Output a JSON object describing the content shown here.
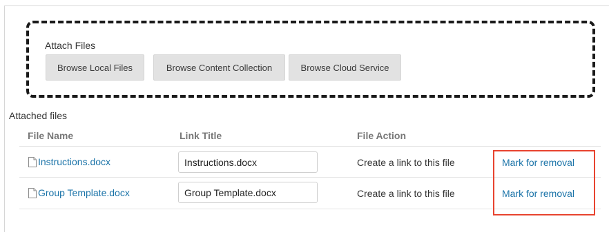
{
  "attach": {
    "label": "Attach Files",
    "buttons": {
      "local": "Browse Local Files",
      "collection": "Browse Content Collection",
      "cloud": "Browse Cloud Service"
    }
  },
  "attached": {
    "heading": "Attached files",
    "columns": {
      "file_name": "File Name",
      "link_title": "Link Title",
      "file_action": "File Action"
    },
    "rows": [
      {
        "file_name": "Instructions.docx",
        "link_title": "Instructions.docx",
        "file_action": "Create a link to this file",
        "remove": "Mark for removal",
        "icon": "document-icon"
      },
      {
        "file_name": "Group Template.docx",
        "link_title": "Group Template.docx",
        "file_action": "Create a link to this file",
        "remove": "Mark for removal",
        "icon": "document-icon"
      }
    ]
  },
  "colors": {
    "link": "#1a73a8",
    "highlight": "#e8432f",
    "button_bg": "#e2e2e2",
    "header_text": "#777777"
  }
}
